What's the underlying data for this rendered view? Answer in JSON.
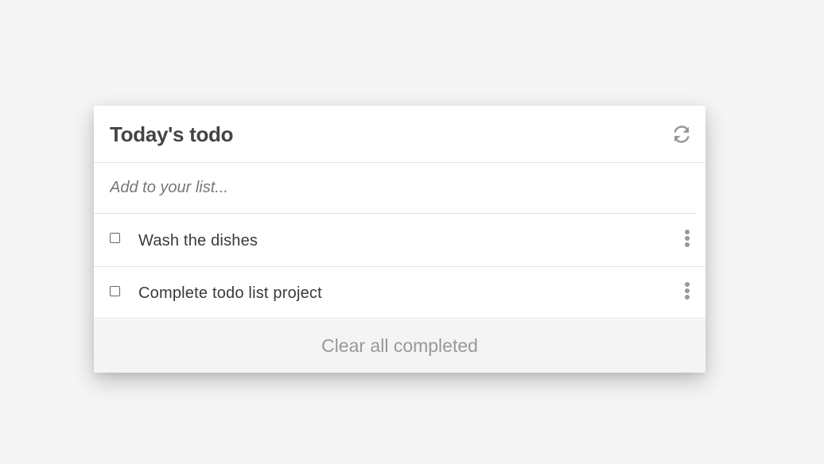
{
  "card": {
    "title": "Today's todo",
    "refresh_icon": "refresh-icon"
  },
  "add_item": {
    "placeholder": "Add to your list...",
    "value": ""
  },
  "items": [
    {
      "label": "Wash the dishes",
      "checked": false,
      "menu_icon": "more-vertical-icon"
    },
    {
      "label": "Complete todo list project",
      "checked": false,
      "menu_icon": "more-vertical-icon"
    }
  ],
  "footer": {
    "clear_label": "Clear all completed"
  },
  "colors": {
    "background": "#f5f5f5",
    "card": "#ffffff",
    "title": "#444444",
    "icon": "#999999",
    "footer_bg": "#f4f4f4",
    "footer_text": "#999999"
  }
}
